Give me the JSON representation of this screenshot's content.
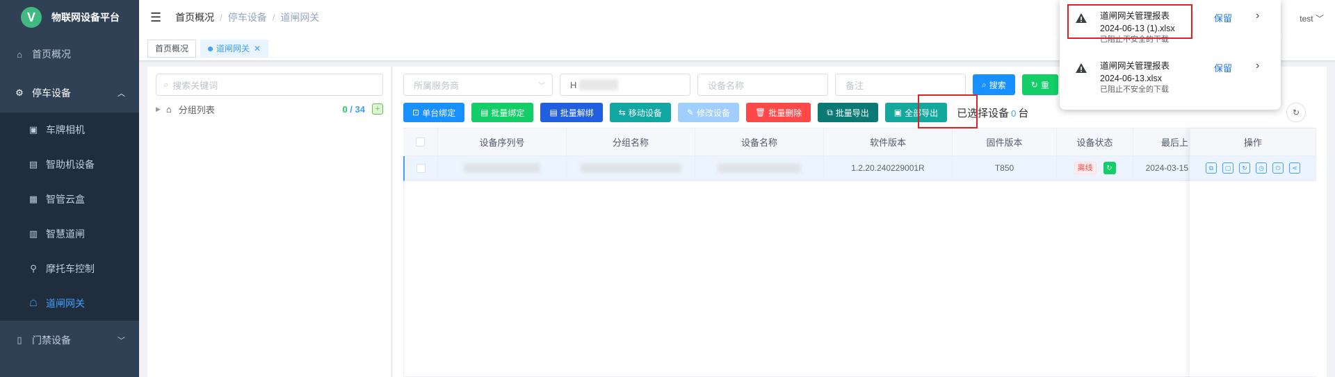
{
  "app": {
    "title": "物联网设备平台",
    "logo_letter": "V"
  },
  "sidebar": {
    "items": [
      {
        "label": "首页概况",
        "icon": "home-icon"
      },
      {
        "label": "停车设备",
        "icon": "devices-icon",
        "expanded": true
      },
      {
        "label": "门禁设备",
        "icon": "door-icon"
      }
    ],
    "sub_items": [
      {
        "label": "车牌相机",
        "icon": "camera-icon"
      },
      {
        "label": "智助机设备",
        "icon": "kiosk-icon"
      },
      {
        "label": "智管云盒",
        "icon": "box-icon"
      },
      {
        "label": "智慧道闸",
        "icon": "barrier-icon"
      },
      {
        "label": "摩托车控制",
        "icon": "motorcycle-icon"
      },
      {
        "label": "道闸网关",
        "icon": "gateway-icon",
        "active": true
      }
    ]
  },
  "header": {
    "breadcrumbs": [
      "首页概况",
      "停车设备",
      "道闸网关"
    ],
    "user": "test"
  },
  "tags": [
    {
      "label": "首页概况",
      "active": false
    },
    {
      "label": "道闸网关",
      "active": true
    }
  ],
  "left": {
    "search_placeholder": "搜索关键词",
    "tree_label": "分组列表",
    "count_selected": "0",
    "count_sep": " / ",
    "count_total": "34"
  },
  "filters": {
    "provider_placeholder": "所属服务商",
    "serial_value": "H",
    "name_placeholder": "设备名称",
    "remark_placeholder": "备注",
    "search_label": "搜索",
    "reset_label": "重"
  },
  "toolbar": {
    "single_bind": "单台绑定",
    "batch_bind": "批量绑定",
    "batch_unbind": "批量解绑",
    "move_device": "移动设备",
    "edit_device": "修改设备",
    "batch_delete": "批量删除",
    "batch_export": "批量导出",
    "export_all": "全部导出",
    "selected_prefix": "已选择设备",
    "selected_count": "0",
    "selected_suffix": "台"
  },
  "table": {
    "headers": [
      "设备序列号",
      "分组名称",
      "设备名称",
      "软件版本",
      "固件版本",
      "设备状态",
      "最后上",
      "操作"
    ],
    "rows": [
      {
        "software": "1.2.20.240229001R",
        "firmware": "T850",
        "status": "离线",
        "last": "2024-03-15"
      }
    ]
  },
  "downloads": {
    "items": [
      {
        "name": "道闸网关管理报表",
        "file": "2024-06-13 (1).xlsx",
        "note": "已阻止不安全的下载",
        "action": "保留"
      },
      {
        "name": "道闸网关管理报表",
        "file": "2024-06-13.xlsx",
        "note": "已阻止不安全的下载",
        "action": "保留"
      }
    ]
  },
  "colors": {
    "sidebar_bg": "#304156",
    "accent": "#409eff",
    "highlight_box": "#e02020"
  }
}
